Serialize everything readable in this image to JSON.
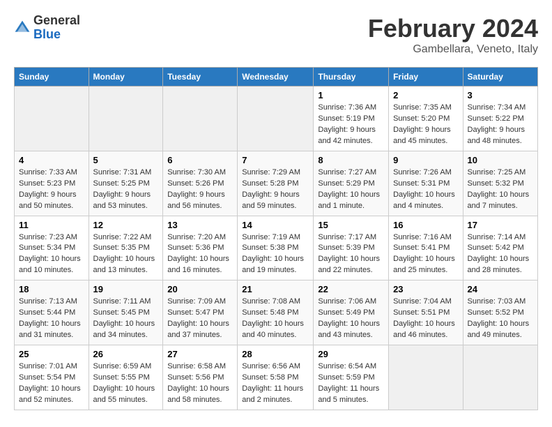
{
  "header": {
    "logo_general": "General",
    "logo_blue": "Blue",
    "title": "February 2024",
    "subtitle": "Gambellara, Veneto, Italy"
  },
  "days_of_week": [
    "Sunday",
    "Monday",
    "Tuesday",
    "Wednesday",
    "Thursday",
    "Friday",
    "Saturday"
  ],
  "weeks": [
    {
      "days": [
        {
          "num": "",
          "info": "",
          "empty": true
        },
        {
          "num": "",
          "info": "",
          "empty": true
        },
        {
          "num": "",
          "info": "",
          "empty": true
        },
        {
          "num": "",
          "info": "",
          "empty": true
        },
        {
          "num": "1",
          "info": "Sunrise: 7:36 AM\nSunset: 5:19 PM\nDaylight: 9 hours and 42 minutes."
        },
        {
          "num": "2",
          "info": "Sunrise: 7:35 AM\nSunset: 5:20 PM\nDaylight: 9 hours and 45 minutes."
        },
        {
          "num": "3",
          "info": "Sunrise: 7:34 AM\nSunset: 5:22 PM\nDaylight: 9 hours and 48 minutes."
        }
      ]
    },
    {
      "days": [
        {
          "num": "4",
          "info": "Sunrise: 7:33 AM\nSunset: 5:23 PM\nDaylight: 9 hours and 50 minutes."
        },
        {
          "num": "5",
          "info": "Sunrise: 7:31 AM\nSunset: 5:25 PM\nDaylight: 9 hours and 53 minutes."
        },
        {
          "num": "6",
          "info": "Sunrise: 7:30 AM\nSunset: 5:26 PM\nDaylight: 9 hours and 56 minutes."
        },
        {
          "num": "7",
          "info": "Sunrise: 7:29 AM\nSunset: 5:28 PM\nDaylight: 9 hours and 59 minutes."
        },
        {
          "num": "8",
          "info": "Sunrise: 7:27 AM\nSunset: 5:29 PM\nDaylight: 10 hours and 1 minute."
        },
        {
          "num": "9",
          "info": "Sunrise: 7:26 AM\nSunset: 5:31 PM\nDaylight: 10 hours and 4 minutes."
        },
        {
          "num": "10",
          "info": "Sunrise: 7:25 AM\nSunset: 5:32 PM\nDaylight: 10 hours and 7 minutes."
        }
      ]
    },
    {
      "days": [
        {
          "num": "11",
          "info": "Sunrise: 7:23 AM\nSunset: 5:34 PM\nDaylight: 10 hours and 10 minutes."
        },
        {
          "num": "12",
          "info": "Sunrise: 7:22 AM\nSunset: 5:35 PM\nDaylight: 10 hours and 13 minutes."
        },
        {
          "num": "13",
          "info": "Sunrise: 7:20 AM\nSunset: 5:36 PM\nDaylight: 10 hours and 16 minutes."
        },
        {
          "num": "14",
          "info": "Sunrise: 7:19 AM\nSunset: 5:38 PM\nDaylight: 10 hours and 19 minutes."
        },
        {
          "num": "15",
          "info": "Sunrise: 7:17 AM\nSunset: 5:39 PM\nDaylight: 10 hours and 22 minutes."
        },
        {
          "num": "16",
          "info": "Sunrise: 7:16 AM\nSunset: 5:41 PM\nDaylight: 10 hours and 25 minutes."
        },
        {
          "num": "17",
          "info": "Sunrise: 7:14 AM\nSunset: 5:42 PM\nDaylight: 10 hours and 28 minutes."
        }
      ]
    },
    {
      "days": [
        {
          "num": "18",
          "info": "Sunrise: 7:13 AM\nSunset: 5:44 PM\nDaylight: 10 hours and 31 minutes."
        },
        {
          "num": "19",
          "info": "Sunrise: 7:11 AM\nSunset: 5:45 PM\nDaylight: 10 hours and 34 minutes."
        },
        {
          "num": "20",
          "info": "Sunrise: 7:09 AM\nSunset: 5:47 PM\nDaylight: 10 hours and 37 minutes."
        },
        {
          "num": "21",
          "info": "Sunrise: 7:08 AM\nSunset: 5:48 PM\nDaylight: 10 hours and 40 minutes."
        },
        {
          "num": "22",
          "info": "Sunrise: 7:06 AM\nSunset: 5:49 PM\nDaylight: 10 hours and 43 minutes."
        },
        {
          "num": "23",
          "info": "Sunrise: 7:04 AM\nSunset: 5:51 PM\nDaylight: 10 hours and 46 minutes."
        },
        {
          "num": "24",
          "info": "Sunrise: 7:03 AM\nSunset: 5:52 PM\nDaylight: 10 hours and 49 minutes."
        }
      ]
    },
    {
      "days": [
        {
          "num": "25",
          "info": "Sunrise: 7:01 AM\nSunset: 5:54 PM\nDaylight: 10 hours and 52 minutes."
        },
        {
          "num": "26",
          "info": "Sunrise: 6:59 AM\nSunset: 5:55 PM\nDaylight: 10 hours and 55 minutes."
        },
        {
          "num": "27",
          "info": "Sunrise: 6:58 AM\nSunset: 5:56 PM\nDaylight: 10 hours and 58 minutes."
        },
        {
          "num": "28",
          "info": "Sunrise: 6:56 AM\nSunset: 5:58 PM\nDaylight: 11 hours and 2 minutes."
        },
        {
          "num": "29",
          "info": "Sunrise: 6:54 AM\nSunset: 5:59 PM\nDaylight: 11 hours and 5 minutes."
        },
        {
          "num": "",
          "info": "",
          "empty": true
        },
        {
          "num": "",
          "info": "",
          "empty": true
        }
      ]
    }
  ]
}
